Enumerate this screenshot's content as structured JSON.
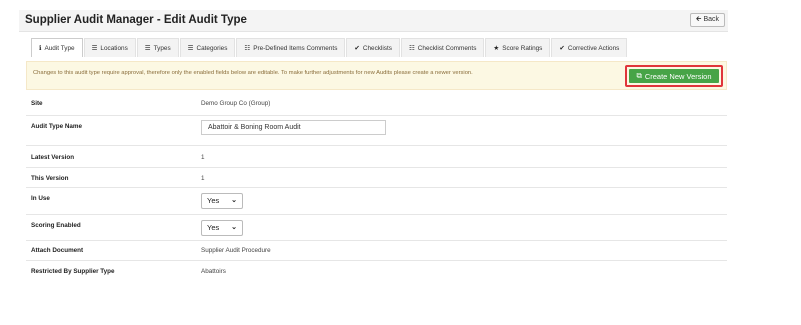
{
  "header": {
    "title": "Supplier Audit Manager - Edit Audit Type",
    "back_label": "Back"
  },
  "tabs": [
    {
      "label": "Audit Type",
      "icon": "info-icon",
      "glyph": "ℹ"
    },
    {
      "label": "Locations",
      "icon": "list-icon",
      "glyph": "☰"
    },
    {
      "label": "Types",
      "icon": "list-icon",
      "glyph": "☰"
    },
    {
      "label": "Categories",
      "icon": "list-icon",
      "glyph": "☰"
    },
    {
      "label": "Pre-Defined Items Comments",
      "icon": "comments-icon",
      "glyph": "☷"
    },
    {
      "label": "Checklists",
      "icon": "check-circle-icon",
      "glyph": "✔"
    },
    {
      "label": "Checklist Comments",
      "icon": "comments-icon",
      "glyph": "☷"
    },
    {
      "label": "Score Ratings",
      "icon": "star-icon",
      "glyph": "★"
    },
    {
      "label": "Corrective Actions",
      "icon": "check-icon",
      "glyph": "✔"
    }
  ],
  "notice": {
    "text": "Changes to this audit type require approval, therefore only the enabled fields below are editable. To make further adjustments for new Audits please create a newer version.",
    "create_label": "Create New Version"
  },
  "fields": {
    "site": {
      "label": "Site",
      "value": "Demo Group Co (Group)"
    },
    "audit_type_name": {
      "label": "Audit Type Name",
      "value": "Abattoir & Boning Room Audit"
    },
    "latest_version": {
      "label": "Latest Version",
      "value": "1"
    },
    "this_version": {
      "label": "This Version",
      "value": "1"
    },
    "in_use": {
      "label": "In Use",
      "value": "Yes"
    },
    "scoring_enabled": {
      "label": "Scoring Enabled",
      "value": "Yes"
    },
    "attach_document": {
      "label": "Attach Document",
      "value": "Supplier Audit Procedure"
    },
    "restricted_by_supplier_type": {
      "label": "Restricted By Supplier Type",
      "value": "Abattoirs"
    }
  }
}
